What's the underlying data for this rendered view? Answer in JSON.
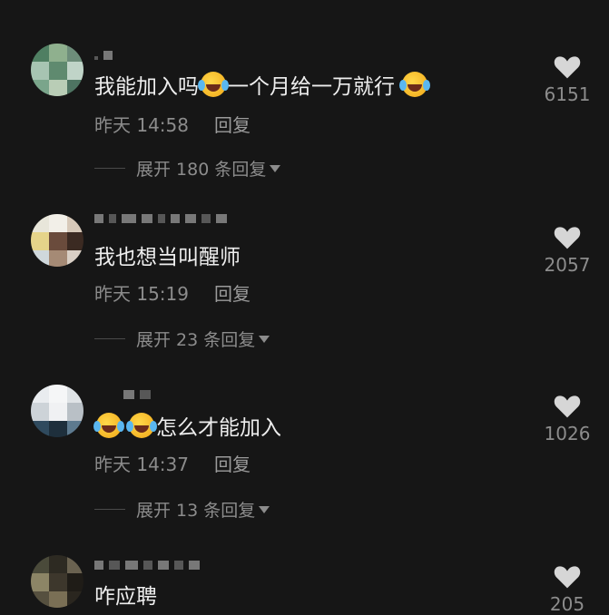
{
  "comments": [
    {
      "text_parts": [
        "我能加入吗",
        "一个月给一万就行"
      ],
      "time": "昨天 14:58",
      "reply_label": "回复",
      "expand_label": "展开 180 条回复",
      "likes": "6151"
    },
    {
      "text": "我也想当叫醒师",
      "time": "昨天 15:19",
      "reply_label": "回复",
      "expand_label": "展开 23 条回复",
      "likes": "2057"
    },
    {
      "text": "怎么才能加入",
      "time": "昨天 14:37",
      "reply_label": "回复",
      "expand_label": "展开 13 条回复",
      "likes": "1026"
    },
    {
      "text": "咋应聘",
      "likes": "205"
    }
  ],
  "icons": {
    "like": "heart-icon",
    "expand": "triangle-down-icon",
    "emoji": "rofl-emoji-icon",
    "emoji_alt": "crying-emoji-icon"
  },
  "colors": {
    "background": "#161616",
    "text": "#eeeeee",
    "secondary": "#8c8c8c",
    "heart": "#d6d6d6"
  }
}
